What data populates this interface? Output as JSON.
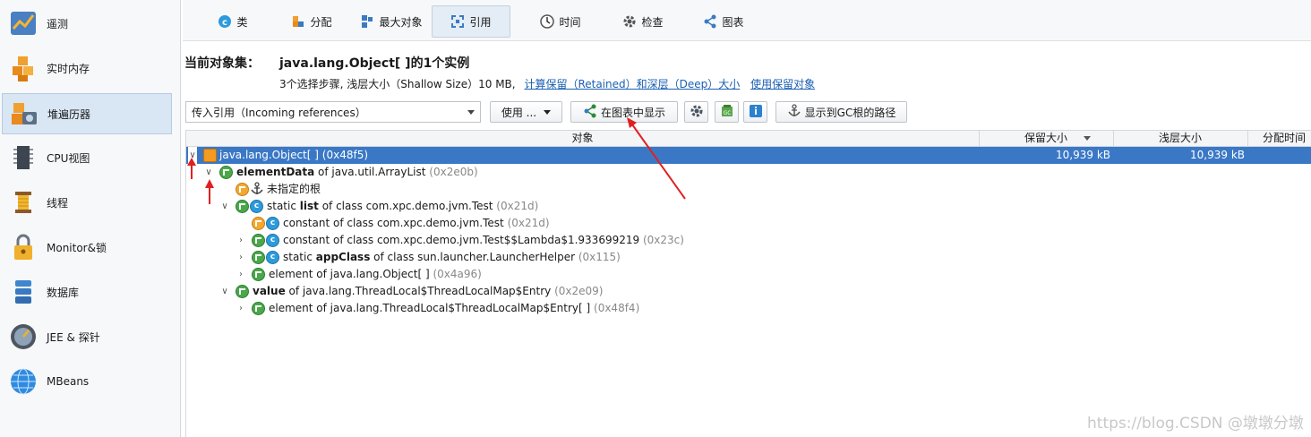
{
  "sidebar": {
    "items": [
      {
        "label": "遥测",
        "icon": "telemetry-icon"
      },
      {
        "label": "实时内存",
        "icon": "live-memory-icon"
      },
      {
        "label": "堆遍历器",
        "icon": "heap-walker-icon",
        "active": true
      },
      {
        "label": "CPU视图",
        "icon": "cpu-icon"
      },
      {
        "label": "线程",
        "icon": "threads-icon"
      },
      {
        "label": "Monitor&锁",
        "icon": "lock-icon"
      },
      {
        "label": "数据库",
        "icon": "database-icon"
      },
      {
        "label": "JEE & 探针",
        "icon": "probe-icon"
      },
      {
        "label": "MBeans",
        "icon": "globe-icon"
      }
    ]
  },
  "tabs": [
    {
      "label": "类",
      "icon": "class-icon"
    },
    {
      "label": "分配",
      "icon": "allocation-icon"
    },
    {
      "label": "最大对象",
      "icon": "biggest-objects-icon"
    },
    {
      "label": "引用",
      "icon": "references-icon",
      "active": true
    },
    {
      "label": "时间",
      "icon": "clock-icon"
    },
    {
      "label": "检查",
      "icon": "gear-icon"
    },
    {
      "label": "图表",
      "icon": "graph-icon"
    }
  ],
  "header": {
    "title": "当前对象集：",
    "object_set": "java.lang.Object[ ]的1个实例",
    "info": "3个选择步骤, 浅层大小（Shallow Size）10 MB,",
    "link_retained": "计算保留（Retained）和深层（Deep）大小",
    "link_use_retained": "使用保留对象"
  },
  "toolbar": {
    "reference_mode": "传入引用（Incoming references）",
    "use_button": "使用 ...",
    "show_in_graph": "在图表中显示",
    "show_gc_path": "显示到GC根的路径"
  },
  "table": {
    "columns": {
      "object": "对象",
      "retained": "保留大小",
      "shallow": "浅层大小",
      "alloc_time": "分配时间"
    },
    "rows": [
      {
        "prefix": "",
        "name": "java.lang.Object[ ]",
        "suffix": "",
        "id": "(0x48f5)",
        "retained": "10,939 kB",
        "shallow": "10,939 kB"
      },
      {
        "prefix": "",
        "name": "elementData",
        "suffix": " of java.util.ArrayList",
        "id": "(0x2e0b)"
      },
      {
        "prefix": "",
        "name": "未指定的根",
        "suffix": "",
        "id": ""
      },
      {
        "prefix": "static ",
        "name": "list",
        "suffix": " of class com.xpc.demo.jvm.Test",
        "id": "(0x21d)"
      },
      {
        "prefix": "constant of class com.xpc.demo.jvm.Test",
        "name": "",
        "suffix": "",
        "id": "(0x21d)"
      },
      {
        "prefix": "constant of class com.xpc.demo.jvm.Test$$Lambda$1.933699219",
        "name": "",
        "suffix": "",
        "id": "(0x23c)"
      },
      {
        "prefix": "static ",
        "name": "appClass",
        "suffix": " of class sun.launcher.LauncherHelper",
        "id": "(0x115)"
      },
      {
        "prefix": "element of java.lang.Object[ ]",
        "name": "",
        "suffix": "",
        "id": "(0x4a96)"
      },
      {
        "prefix": "",
        "name": "value",
        "suffix": " of java.lang.ThreadLocal$ThreadLocalMap$Entry",
        "id": "(0x2e09)"
      },
      {
        "prefix": "element of java.lang.ThreadLocal$ThreadLocalMap$Entry[ ]",
        "name": "",
        "suffix": "",
        "id": "(0x48f4)"
      }
    ]
  },
  "watermark": "https://blog.CSDN @墩墩分墩",
  "colors": {
    "selection": "#3a78c6",
    "link": "#1a5fb4",
    "annotation": "#e02020"
  }
}
